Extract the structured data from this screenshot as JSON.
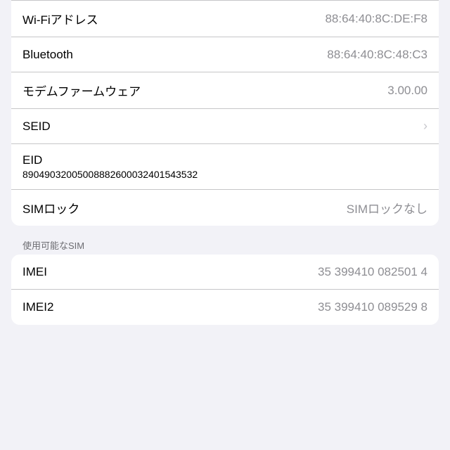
{
  "rows": {
    "wifi_label": "Wi-Fiアドレス",
    "wifi_value": "88:64:40:8C:DE:F8",
    "bluetooth_label": "Bluetooth",
    "bluetooth_value": "88:64:40:8C:48:C3",
    "modem_label": "モデムファームウェア",
    "modem_value": "3.00.00",
    "seid_label": "SEID",
    "eid_label": "EID",
    "eid_value": "89049032005008882600032401543532",
    "simlock_label": "SIMロック",
    "simlock_value": "SIMロックなし",
    "available_sim_label": "使用可能なSIM",
    "imei_label": "IMEI",
    "imei_value": "35 399410 082501 4",
    "imei2_label": "IMEI2",
    "imei2_value": "35 399410 089529 8"
  }
}
